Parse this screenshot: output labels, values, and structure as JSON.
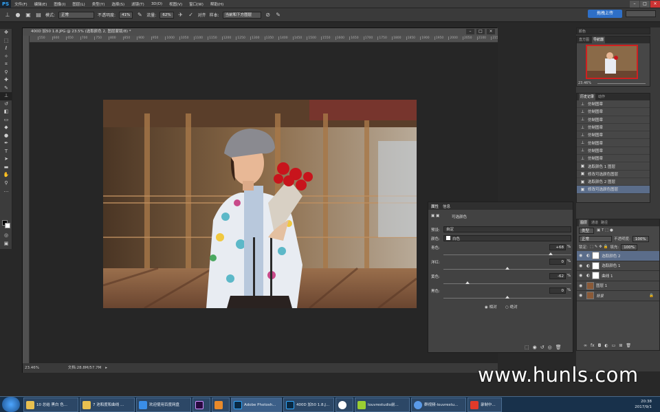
{
  "app": {
    "logo": "PS",
    "menu": [
      "文件(F)",
      "编辑(E)",
      "图像(I)",
      "图层(L)",
      "类型(Y)",
      "选择(S)",
      "滤镜(T)",
      "3D(D)",
      "视图(V)",
      "窗口(W)",
      "帮助(H)"
    ]
  },
  "options": {
    "mode_label": "模式:",
    "mode_value": "正常",
    "opacity_label": "不透明度:",
    "opacity_value": "41%",
    "flow_label": "流量:",
    "flow_value": "62%",
    "align_label": "对齐",
    "sample_label": "样本:",
    "sample_value": "当前和下方图层"
  },
  "upload": "拖拽上传",
  "document": {
    "tab_title": "400D 加50 1.8.JPG @ 23.5% (选取颜色 2, 图层蒙版/8) *",
    "ruler_marks": [
      "550",
      "600",
      "650",
      "700",
      "750",
      "800",
      "850",
      "900",
      "950",
      "1000",
      "1050",
      "1100",
      "1150",
      "1200",
      "1250",
      "1300",
      "1350",
      "1400",
      "1450",
      "1500",
      "1550",
      "1600",
      "1650",
      "1700",
      "1750",
      "1800",
      "1850",
      "1900",
      "1950",
      "2000",
      "2050",
      "2100",
      "2150"
    ],
    "zoom": "23.46%",
    "doc_size": "文档:28.8M/57.7M"
  },
  "properties": {
    "tab_props": "属性",
    "tab_info": "信息",
    "title": "可选颜色",
    "preset_label": "预设:",
    "preset_value": "自定",
    "color_label": "颜色:",
    "color_value": "白色",
    "sliders": [
      {
        "name": "青色:",
        "value": "+68",
        "pos": 0.84
      },
      {
        "name": "洋红:",
        "value": "0",
        "pos": 0.5
      },
      {
        "name": "黄色:",
        "value": "-62",
        "pos": 0.19
      },
      {
        "name": "黑色:",
        "value": "0",
        "pos": 0.5
      }
    ],
    "pct": "%",
    "relative": "相对",
    "absolute": "绝对"
  },
  "navigator": {
    "tab1": "直方图",
    "tab2": "导航器",
    "zoom": "23.46%",
    "panel_name": "颜色"
  },
  "history": {
    "tab1": "历史记录",
    "tab2": "动作",
    "items": [
      "仿制图章",
      "仿制图章",
      "仿制图章",
      "仿制图章",
      "仿制图章",
      "仿制图章",
      "仿制图章",
      "仿制图章",
      "选取颜色 1 图层",
      "修改可选颜色图层",
      "选取颜色 2 图层",
      "修改可选颜色图层"
    ]
  },
  "layers": {
    "tabs": [
      "图层",
      "通道",
      "路径"
    ],
    "kind": "类型",
    "blend": "正常",
    "opacity_label": "不透明度:",
    "opacity_value": "100%",
    "lock_label": "锁定:",
    "fill_label": "填充:",
    "fill_value": "100%",
    "rows": [
      {
        "label": "选取颜色 2",
        "sel": true
      },
      {
        "label": "选取颜色 1",
        "sel": false
      },
      {
        "label": "曲线 1",
        "sel": false
      },
      {
        "label": "图层 1",
        "sel": false
      },
      {
        "label": "背景",
        "sel": false
      }
    ]
  },
  "taskbar": {
    "items": [
      "10 总结 黑白 色...",
      "7 池和度和曲线 ...",
      "欢迎使用百度网盘",
      "",
      "",
      "Adobe Photosh...",
      "400D 加50 1.8.J...",
      "",
      "louvrestudio前...",
      "群视频-louvrestu...",
      "录制中..."
    ],
    "time": "20:38",
    "date": "2017/9/1"
  },
  "watermark": "www.hunls.com",
  "colors": {
    "accent": "#5b6d8a",
    "panel": "#424242",
    "taskbar": "#18314b"
  }
}
